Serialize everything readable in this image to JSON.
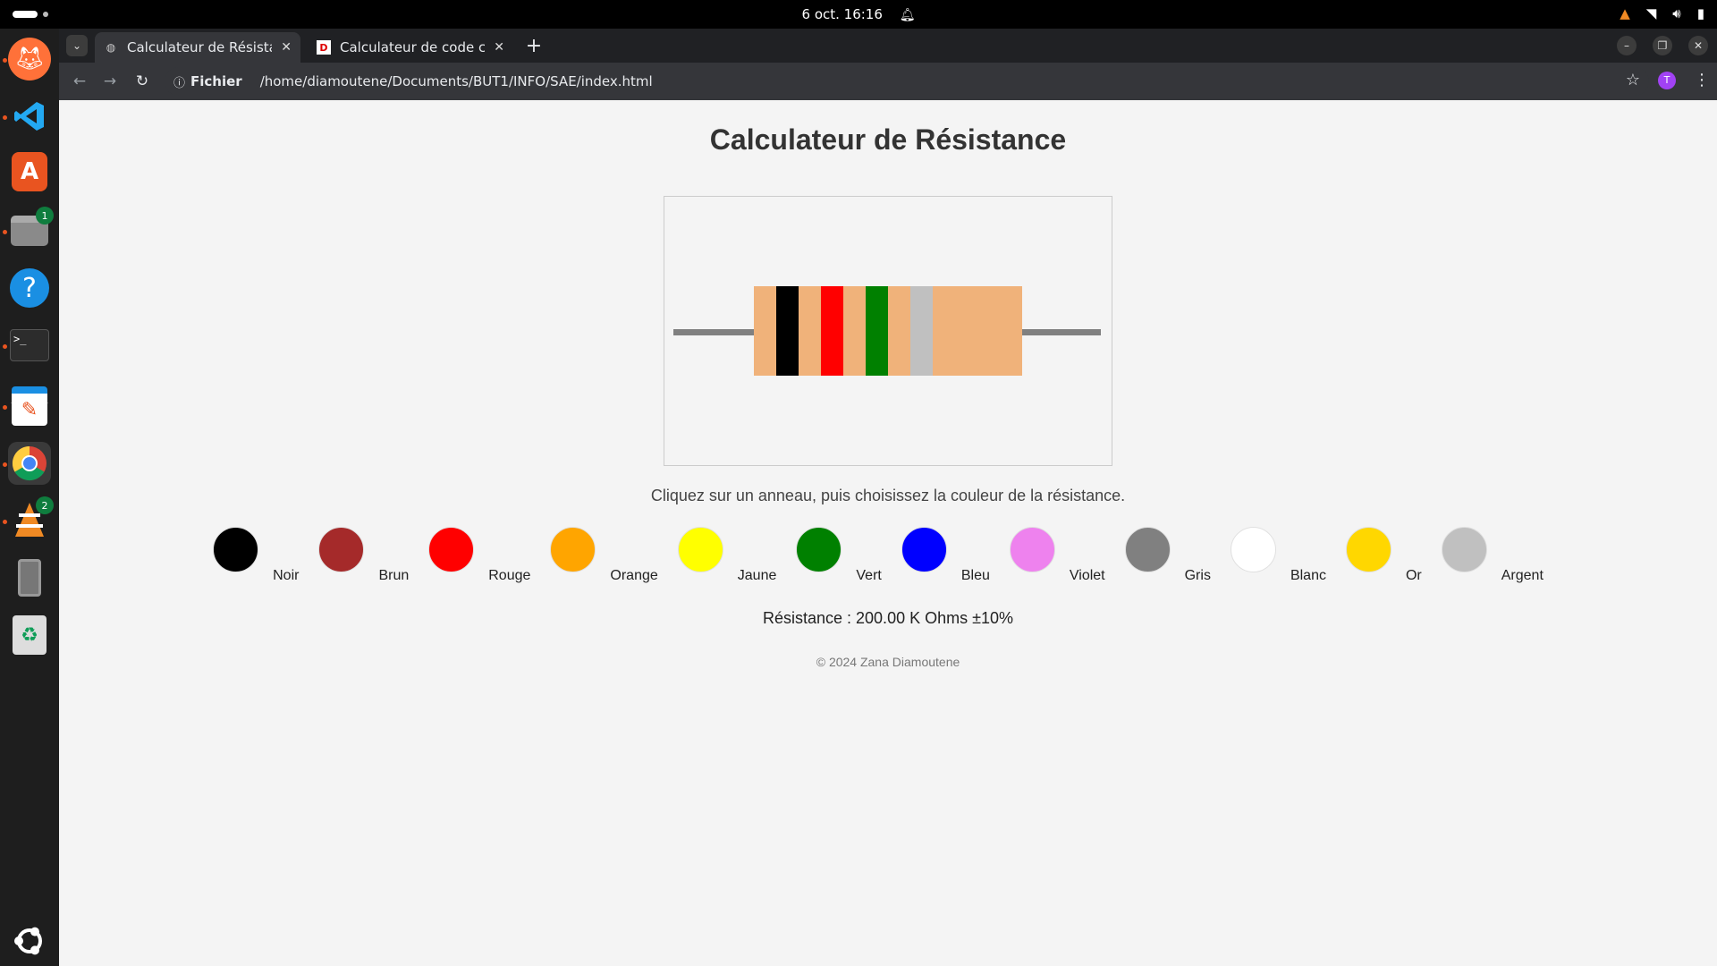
{
  "topbar": {
    "clock": "6 oct.  16:16",
    "tray_icons": [
      "vlc-tray-icon",
      "wifi-icon",
      "volume-icon",
      "battery-icon"
    ]
  },
  "dock": {
    "items": [
      {
        "name": "firefox",
        "glyph": "🦊",
        "running": true
      },
      {
        "name": "vscode",
        "glyph": "⟩",
        "running": true
      },
      {
        "name": "app-center",
        "glyph": "A",
        "running": false
      },
      {
        "name": "files",
        "glyph": "▬",
        "running": true,
        "badge": "1"
      },
      {
        "name": "help",
        "glyph": "?",
        "running": false
      },
      {
        "name": "terminal",
        "glyph": ">_",
        "running": true
      },
      {
        "name": "text-editor",
        "glyph": "✎",
        "running": true
      },
      {
        "name": "chrome",
        "glyph": "◉",
        "running": true,
        "active": true
      },
      {
        "name": "vlc",
        "glyph": "▲",
        "running": true,
        "badge": "2"
      },
      {
        "name": "device",
        "glyph": "▯",
        "running": false
      },
      {
        "name": "trash",
        "glyph": "♻",
        "running": false
      }
    ]
  },
  "browser": {
    "tabs": [
      {
        "title": "Calculateur de Résistance",
        "active": true
      },
      {
        "title": "Calculateur de code couleur",
        "active": false
      }
    ],
    "omnibox": {
      "scheme_label": "Fichier",
      "url": "/home/diamoutene/Documents/BUT1/INFO/SAE/index.html"
    },
    "avatar_letter": "T"
  },
  "page": {
    "title": "Calculateur de Résistance",
    "hint": "Cliquez sur un anneau, puis choisissez la couleur de la résistance.",
    "resistor": {
      "body_color": "#f0b27a",
      "bands": [
        "#000000",
        "#ff0000",
        "#008000",
        "#c0c0c0"
      ]
    },
    "colors": [
      {
        "label": "Noir",
        "hex": "#000000"
      },
      {
        "label": "Brun",
        "hex": "#a52a2a"
      },
      {
        "label": "Rouge",
        "hex": "#ff0000"
      },
      {
        "label": "Orange",
        "hex": "#ffa500"
      },
      {
        "label": "Jaune",
        "hex": "#ffff00"
      },
      {
        "label": "Vert",
        "hex": "#008000"
      },
      {
        "label": "Bleu",
        "hex": "#0000ff"
      },
      {
        "label": "Violet",
        "hex": "#ee82ee"
      },
      {
        "label": "Gris",
        "hex": "#808080"
      },
      {
        "label": "Blanc",
        "hex": "#ffffff"
      },
      {
        "label": "Or",
        "hex": "#ffd700"
      },
      {
        "label": "Argent",
        "hex": "#c0c0c0"
      }
    ],
    "result": "Résistance : 200.00 K Ohms ±10%",
    "footer": "© 2024 Zana Diamoutene"
  }
}
